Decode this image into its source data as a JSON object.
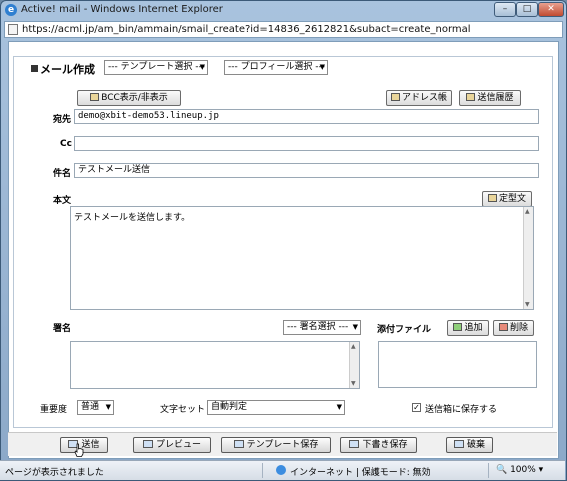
{
  "window": {
    "title": "Active! mail - Windows Internet Explorer",
    "url": "https://acml.jp/am_bin/ammain/smail_create?id=14836_2612821&subact=create_normal"
  },
  "compose": {
    "heading": "メール作成",
    "template_select": "--- テンプレート選択 ---",
    "profile_select": "--- プロフィール選択 ---",
    "bcc_button": "BCC表示/非表示",
    "address_book_button": "アドレス帳",
    "sent_history_button": "送信履歴",
    "to_label": "宛先",
    "to_value": "demo@xbit-demo53.lineup.jp",
    "cc_label": "Cc",
    "cc_value": "",
    "subject_label": "件名",
    "subject_value": "テストメール送信",
    "body_label": "本文",
    "fixed_text_button": "定型文",
    "body_value": "テストメールを送信します。",
    "signature_label": "署名",
    "signature_select": "--- 署名選択 ---",
    "attachment_label": "添付ファイル",
    "add_button": "追加",
    "delete_button": "削除",
    "priority_label": "重要度",
    "priority_value": "普通",
    "charset_label": "文字セット",
    "charset_value": "自動判定",
    "save_to_sent_label": "送信箱に保存する",
    "save_to_sent_checked": true
  },
  "actions": {
    "send": "送信",
    "preview": "プレビュー",
    "save_template": "テンプレート保存",
    "save_draft": "下書き保存",
    "discard": "破棄"
  },
  "status": {
    "text": "ページが表示されました",
    "zone": "インターネット | 保護モード: 無効",
    "zoom": "100%"
  }
}
